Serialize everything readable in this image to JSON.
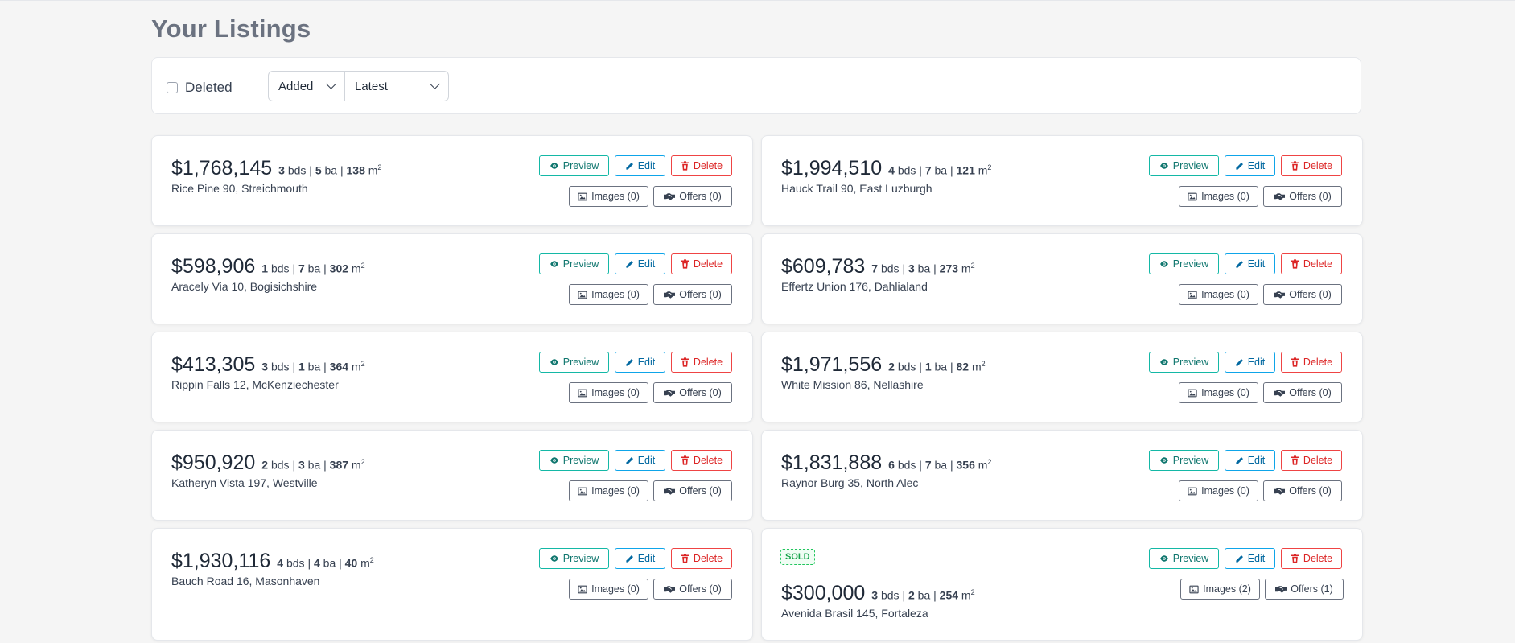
{
  "page": {
    "title": "Your Listings"
  },
  "filters": {
    "deleted_label": "Deleted",
    "sort_field": "Added",
    "sort_order": "Latest"
  },
  "labels": {
    "preview": "Preview",
    "edit": "Edit",
    "delete": "Delete",
    "beds_unit": "bds",
    "baths_unit": "ba",
    "area_unit": "m",
    "area_sup": "2",
    "separator": "|"
  },
  "colors": {
    "preview": "#14b8a6",
    "edit": "#0ea5e9",
    "delete": "#ef4444",
    "sold": "#22c55e"
  },
  "listings": [
    {
      "price": "$1,768,145",
      "beds": "3",
      "baths": "5",
      "area": "138",
      "address": "Rice Pine 90, Streichmouth",
      "images": "Images (0)",
      "offers": "Offers (0)"
    },
    {
      "price": "$1,994,510",
      "beds": "4",
      "baths": "7",
      "area": "121",
      "address": "Hauck Trail 90, East Luzburgh",
      "images": "Images (0)",
      "offers": "Offers (0)"
    },
    {
      "price": "$598,906",
      "beds": "1",
      "baths": "7",
      "area": "302",
      "address": "Aracely Via 10, Bogisichshire",
      "images": "Images (0)",
      "offers": "Offers (0)"
    },
    {
      "price": "$609,783",
      "beds": "7",
      "baths": "3",
      "area": "273",
      "address": "Effertz Union 176, Dahlialand",
      "images": "Images (0)",
      "offers": "Offers (0)"
    },
    {
      "price": "$413,305",
      "beds": "3",
      "baths": "1",
      "area": "364",
      "address": "Rippin Falls 12, McKenziechester",
      "images": "Images (0)",
      "offers": "Offers (0)"
    },
    {
      "price": "$1,971,556",
      "beds": "2",
      "baths": "1",
      "area": "82",
      "address": "White Mission 86, Nellashire",
      "images": "Images (0)",
      "offers": "Offers (0)"
    },
    {
      "price": "$950,920",
      "beds": "2",
      "baths": "3",
      "area": "387",
      "address": "Katheryn Vista 197, Westville",
      "images": "Images (0)",
      "offers": "Offers (0)"
    },
    {
      "price": "$1,831,888",
      "beds": "6",
      "baths": "7",
      "area": "356",
      "address": "Raynor Burg 35, North Alec",
      "images": "Images (0)",
      "offers": "Offers (0)"
    },
    {
      "price": "$1,930,116",
      "beds": "4",
      "baths": "4",
      "area": "40",
      "address": "Bauch Road 16, Masonhaven",
      "images": "Images (0)",
      "offers": "Offers (0)"
    },
    {
      "price": "$300,000",
      "beds": "3",
      "baths": "2",
      "area": "254",
      "address": "Avenida Brasil 145, Fortaleza",
      "images": "Images (2)",
      "offers": "Offers (1)",
      "badge": "SOLD"
    }
  ]
}
